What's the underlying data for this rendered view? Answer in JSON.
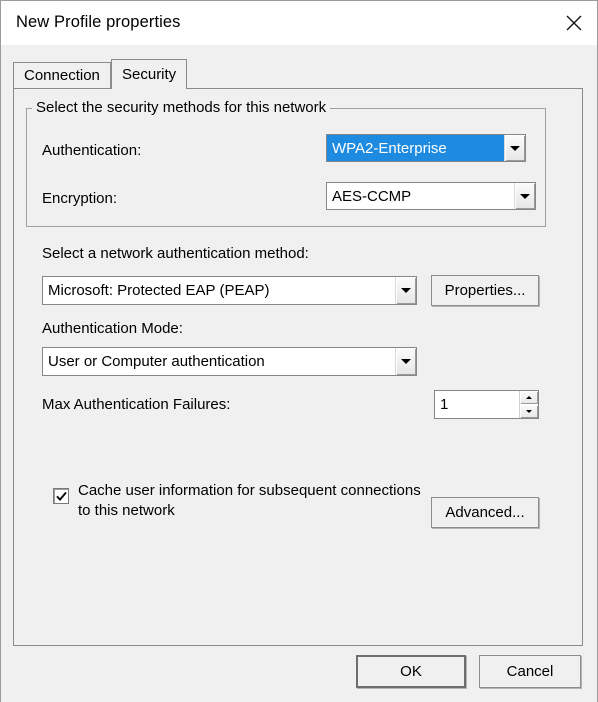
{
  "window": {
    "title": "New Profile properties",
    "close_icon": "close-icon"
  },
  "tabs": [
    {
      "label": "Connection",
      "selected": false
    },
    {
      "label": "Security",
      "selected": true
    }
  ],
  "security_group": {
    "legend": "Select the security methods for this network",
    "authentication": {
      "label": "Authentication:",
      "value": "WPA2-Enterprise",
      "highlighted": true
    },
    "encryption": {
      "label": "Encryption:",
      "value": "AES-CCMP",
      "highlighted": false
    }
  },
  "auth_method": {
    "label": "Select a network authentication method:",
    "value": "Microsoft: Protected EAP (PEAP)",
    "properties_button": "Properties..."
  },
  "auth_mode": {
    "label": "Authentication Mode:",
    "value": "User or Computer authentication"
  },
  "max_failures": {
    "label": "Max Authentication Failures:",
    "value": "1"
  },
  "cache_checkbox": {
    "label_line1": "Cache user information for subsequent connections",
    "label_line2": "to this network",
    "checked": true,
    "check_glyph": "✔"
  },
  "advanced_button": "Advanced...",
  "footer": {
    "ok": "OK",
    "cancel": "Cancel"
  },
  "colors": {
    "dialog_background": "#f0f0f0",
    "titlebar_background": "#ffffff",
    "selection_blue": "#1e8ae0",
    "border_gray": "#8c8c8c",
    "text": "#000000"
  }
}
